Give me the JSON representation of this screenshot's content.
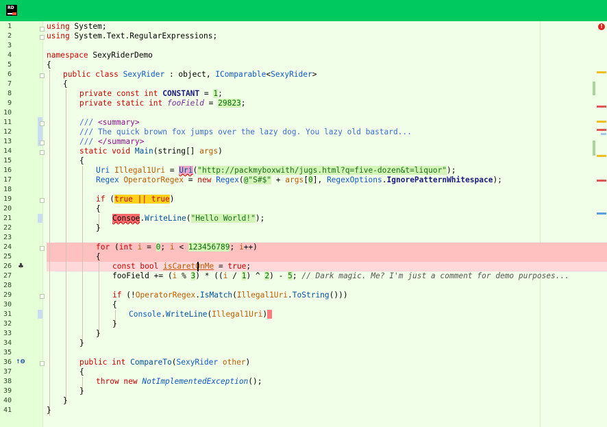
{
  "app": {
    "icon_text": "RD"
  },
  "editor": {
    "error_indicator": "!",
    "line_numbers": [
      "1",
      "2",
      "3",
      "4",
      "5",
      "6",
      "7",
      "8",
      "9",
      "10",
      "11",
      "12",
      "13",
      "14",
      "15",
      "16",
      "17",
      "18",
      "19",
      "20",
      "21",
      "22",
      "23",
      "24",
      "25",
      "26",
      "27",
      "28",
      "29",
      "30",
      "31",
      "32",
      "33",
      "34",
      "35",
      "36",
      "37",
      "38",
      "39",
      "40",
      "41"
    ],
    "lines": {
      "l1": [
        "using",
        " System;"
      ],
      "l2": [
        "using",
        " System.Text.RegularExpressions;"
      ],
      "l4": [
        "namespace",
        " SexyRiderDemo"
      ],
      "l5": [
        "{"
      ],
      "l6": [
        "public class",
        " ",
        "SexyRider",
        " : object, ",
        "IComparable",
        "<",
        "SexyRider",
        ">"
      ],
      "l7": [
        "{"
      ],
      "l8": [
        "private const int",
        " ",
        "CONSTANT",
        " = ",
        "1",
        ";"
      ],
      "l9": [
        "private static int",
        " ",
        "fooField",
        " = ",
        "29823",
        ";"
      ],
      "l11": [
        "/// ",
        "<summary>"
      ],
      "l12": [
        "/// The quick brown fox jumps over the lazy dog. You lazy old bastard..."
      ],
      "l13": [
        "/// ",
        "</summary>"
      ],
      "l14": [
        "static void",
        " ",
        "Main",
        "(string[] ",
        "args",
        ")"
      ],
      "l15": [
        "{"
      ],
      "l16": [
        "Uri",
        " ",
        "Illegal1Uri",
        " = ",
        "Uri",
        "(",
        "\"http://packmyboxwith/jugs.html?q=five-dozen&t=liquor\"",
        ");"
      ],
      "l17": [
        "Regex",
        " ",
        "OperatorRegex",
        " = ",
        "new",
        " ",
        "Regex",
        "(",
        "@\"S#$\"",
        " + ",
        "args",
        "[",
        "0",
        "], ",
        "RegexOptions",
        ".",
        "IgnorePatternWhitespace",
        ");"
      ],
      "l19": [
        "if",
        " (",
        "true || true",
        ")"
      ],
      "l20": [
        "{"
      ],
      "l21": [
        "Consoe",
        ".",
        "WriteLine",
        "(",
        "\"Hello World!\"",
        ");"
      ],
      "l22": [
        "}"
      ],
      "l24": [
        "for",
        " (",
        "int",
        " ",
        "i",
        " = ",
        "0",
        "; ",
        "i",
        " < ",
        "123456789",
        "; ",
        "i",
        "++)"
      ],
      "l25": [
        "{"
      ],
      "l26": [
        "const bool",
        " ",
        "isCaretOnMe",
        " = ",
        "true",
        ";"
      ],
      "l27": [
        "fooField",
        " += (",
        "i",
        " % ",
        "3",
        ") * ((",
        "i",
        " / ",
        "1",
        ") ^ ",
        "2",
        ") - ",
        "5",
        "; ",
        "// Dark magic. Me? I'm just a comment for demo purposes..."
      ],
      "l29": [
        "if",
        " (!",
        "OperatorRegex",
        ".",
        "IsMatch",
        "(",
        "Illegal1Uri",
        ".",
        "ToString",
        "()))"
      ],
      "l30": [
        "{"
      ],
      "l31": [
        "Console",
        ".",
        "WriteLine",
        "(",
        "Illegal1Uri",
        ")",
        " "
      ],
      "l32": [
        "}"
      ],
      "l33": [
        "}"
      ],
      "l34": [
        "}"
      ],
      "l36": [
        "public int",
        " ",
        "CompareTo",
        "(",
        "SexyRider",
        " ",
        "other",
        ")"
      ],
      "l37": [
        "{"
      ],
      "l38": [
        "throw new",
        " ",
        "NotImplementedException",
        "();"
      ],
      "l39": [
        "}"
      ],
      "l40": [
        "}"
      ],
      "l41": [
        "}"
      ]
    }
  },
  "colors": {
    "titlebar": "#00c960",
    "background": "#f2ffe8",
    "gutter": "#e5ffd6",
    "error_line_highlight": "#ffc0c0",
    "keyword": "#cc0000",
    "type": "#0f5ac5",
    "string_bg": "#d4f5b8",
    "warning_bg": "#ffd21a",
    "error_bg": "#ff6b6b"
  },
  "icons": {
    "app": "rider-app-icon",
    "error": "error-stripe-icon",
    "brush": "paintbrush-icon",
    "implements": "implements-up-arrow-icon"
  }
}
